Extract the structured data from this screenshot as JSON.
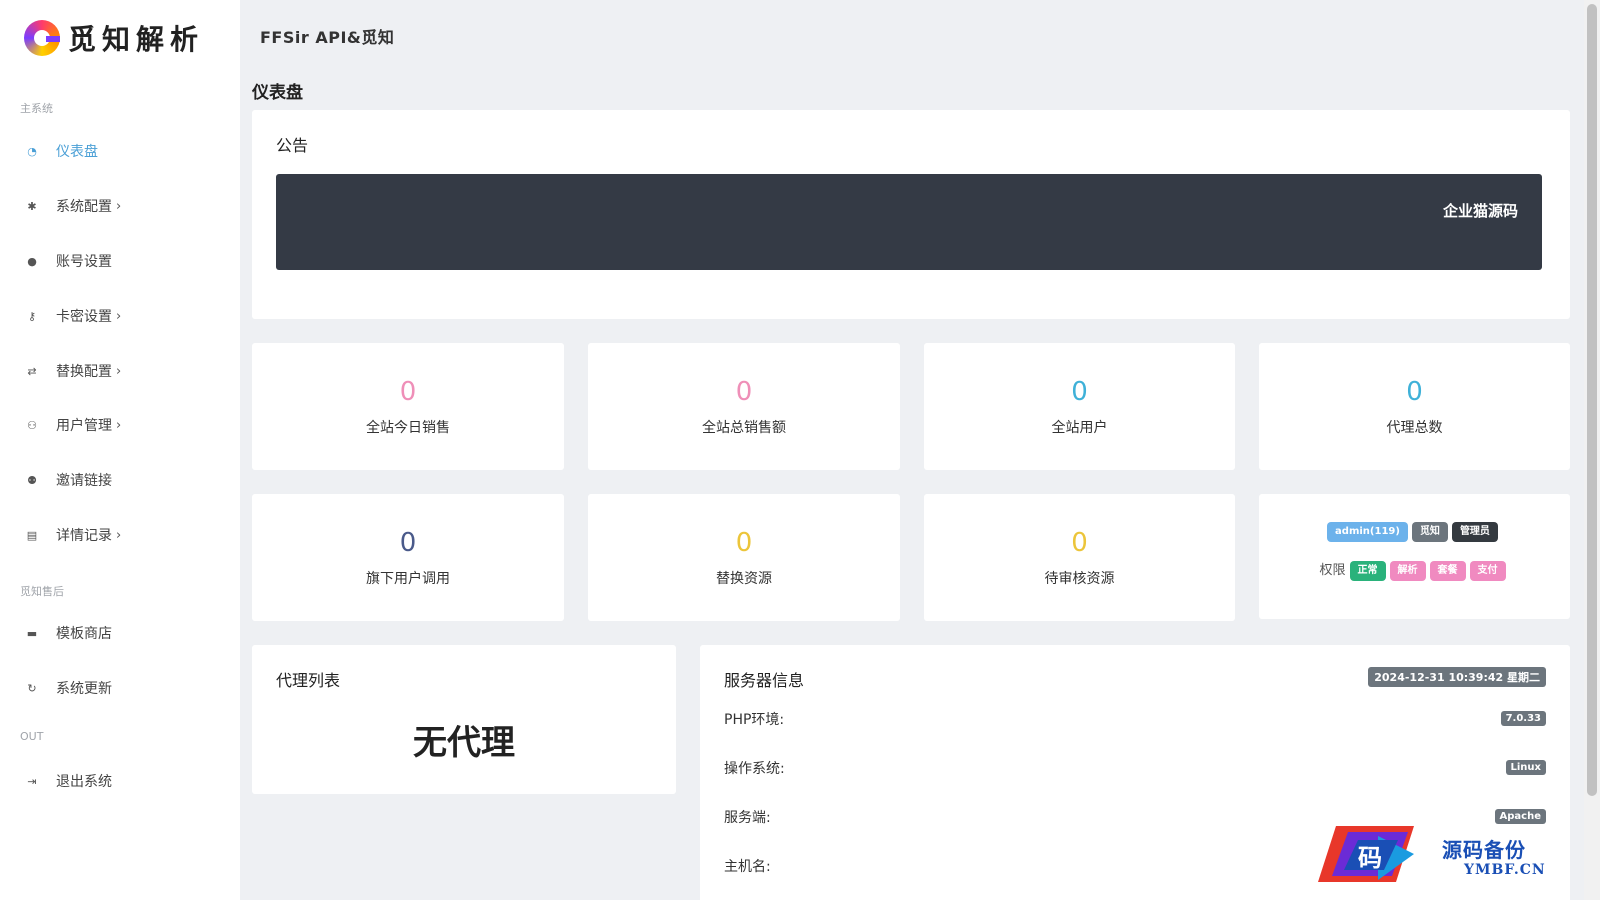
{
  "logo": {
    "text": "觅知解析"
  },
  "header": {
    "title": "FFSir API&觅知"
  },
  "page": {
    "title": "仪表盘"
  },
  "sidebar": {
    "section_main": "主系统",
    "section_aftersale": "觅知售后",
    "section_out": "OUT",
    "items": [
      {
        "label": "仪表盘",
        "icon": "dashboard-icon",
        "glyph": "◔"
      },
      {
        "label": "系统配置",
        "icon": "gear-icon",
        "glyph": "✱"
      },
      {
        "label": "账号设置",
        "icon": "user-icon",
        "glyph": "●"
      },
      {
        "label": "卡密设置",
        "icon": "key-icon",
        "glyph": "⚷"
      },
      {
        "label": "替换配置",
        "icon": "swap-icon",
        "glyph": "⇄"
      },
      {
        "label": "用户管理",
        "icon": "users-icon",
        "glyph": "⚇"
      },
      {
        "label": "邀请链接",
        "icon": "user-plus-icon",
        "glyph": "⚉"
      },
      {
        "label": "详情记录",
        "icon": "clipboard-icon",
        "glyph": "▤"
      },
      {
        "label": "模板商店",
        "icon": "store-icon",
        "glyph": "▬"
      },
      {
        "label": "系统更新",
        "icon": "refresh-icon",
        "glyph": "↻"
      },
      {
        "label": "退出系统",
        "icon": "logout-icon",
        "glyph": "⇥"
      }
    ]
  },
  "notice": {
    "title": "公告",
    "text": "企业猫源码"
  },
  "stats": [
    {
      "value": "0",
      "label": "全站今日销售",
      "color": "#ef8fb8"
    },
    {
      "value": "0",
      "label": "全站总销售额",
      "color": "#ef8fb8"
    },
    {
      "value": "0",
      "label": "全站用户",
      "color": "#3fb1d8"
    },
    {
      "value": "0",
      "label": "代理总数",
      "color": "#3fb1d8"
    },
    {
      "value": "0",
      "label": "旗下用户调用",
      "color": "#4a5a8a"
    },
    {
      "value": "0",
      "label": "替换资源",
      "color": "#ecc53a"
    },
    {
      "value": "0",
      "label": "待审核资源",
      "color": "#ecc53a"
    }
  ],
  "user_card": {
    "badges": [
      {
        "text": "admin(119)",
        "color": "#6cb2eb"
      },
      {
        "text": "觅知",
        "color": "#6c757d"
      },
      {
        "text": "管理员",
        "color": "#343a40"
      }
    ],
    "perm_label": "权限",
    "perms": [
      {
        "text": "正常",
        "color": "#2ab27b"
      },
      {
        "text": "解析",
        "color": "#f08ac0"
      },
      {
        "text": "套餐",
        "color": "#f08ac0"
      },
      {
        "text": "支付",
        "color": "#f08ac0"
      }
    ]
  },
  "agents": {
    "title": "代理列表",
    "empty": "无代理"
  },
  "server": {
    "title": "服务器信息",
    "time": "2024-12-31 10:39:42 星期二",
    "rows": [
      {
        "label": "PHP环境:",
        "value": "7.0.33"
      },
      {
        "label": "操作系统:",
        "value": "Linux"
      },
      {
        "label": "服务端:",
        "value": "Apache"
      },
      {
        "label": "主机名:",
        "value": ""
      }
    ]
  },
  "watermark": {
    "line1": "源码备份",
    "line2": "YMBF.CN",
    "mark": "码"
  }
}
